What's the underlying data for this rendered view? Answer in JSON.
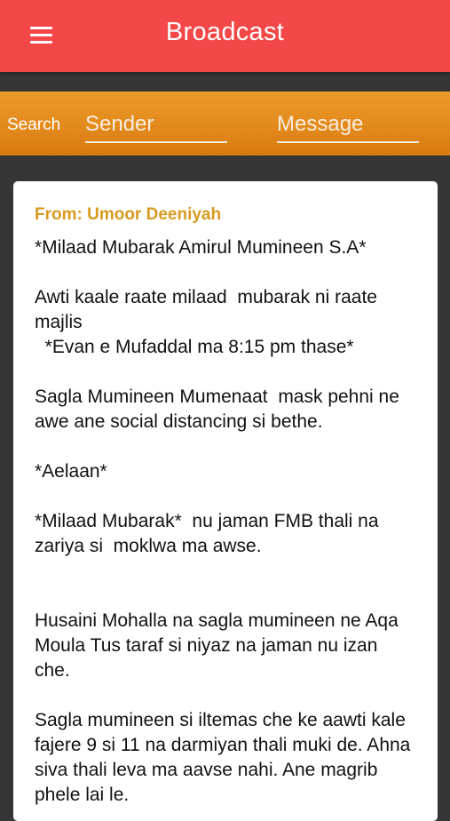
{
  "appbar": {
    "title": "Broadcast",
    "menu_icon": "hamburger-menu-icon",
    "color": "#f44747"
  },
  "search": {
    "label": "Search",
    "sender_placeholder": "Sender",
    "message_placeholder": "Message",
    "sender_value": "",
    "message_value": "",
    "color": "#e38a1d"
  },
  "broadcasts": [
    {
      "from": "From: Umoor Deeniyah",
      "message": "*Milaad Mubarak Amirul Mumineen S.A*\n\nAwti kaale raate milaad  mubarak ni raate majlis\n  *Evan e Mufaddal ma 8:15 pm thase*\n\nSagla Mumineen Mumenaat  mask pehni ne awe ane social distancing si bethe.\n\n*Aelaan*\n\n*Milaad Mubarak*  nu jaman FMB thali na zariya si  moklwa ma awse.\n\n\nHusaini Mohalla na sagla mumineen ne Aqa Moula Tus taraf si niyaz na jaman nu izan che.\n\nSagla mumineen si iltemas che ke aawti kale fajere 9 si 11 na darmiyan thali muki de. Ahna siva thali leva ma aavse nahi. Ane magrib phele lai le."
    }
  ],
  "colors": {
    "from_text": "#d79a1f",
    "background": "#353535"
  }
}
